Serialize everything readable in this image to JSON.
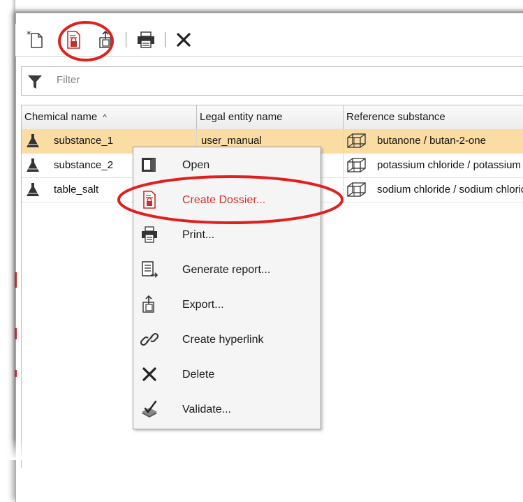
{
  "accent_color": "#d2312e",
  "selected_row_color": "#fbdca2",
  "toolbar": {
    "buttons": [
      {
        "name": "new-icon"
      },
      {
        "name": "create-dossier-icon"
      },
      {
        "name": "export-icon"
      },
      {
        "name": "print-icon"
      },
      {
        "name": "delete-icon"
      }
    ]
  },
  "filter": {
    "placeholder": "Filter"
  },
  "table": {
    "columns": [
      "Chemical name",
      "Legal entity name",
      "Reference substance"
    ],
    "sort_indicator": "^",
    "rows": [
      {
        "chemical_name": "substance_1",
        "legal_entity": "user_manual",
        "reference": "butanone / butan-2-one"
      },
      {
        "chemical_name": "substance_2",
        "legal_entity": "",
        "reference": "potassium chloride / potassium chloride"
      },
      {
        "chemical_name": "table_salt",
        "legal_entity": "",
        "reference": "sodium chloride / sodium chloride"
      }
    ]
  },
  "context_menu": {
    "items": [
      {
        "label": "Open",
        "icon": "open-icon"
      },
      {
        "label": "Create Dossier...",
        "icon": "create-dossier-icon",
        "highlighted": true
      },
      {
        "label": "Print...",
        "icon": "print-icon"
      },
      {
        "label": "Generate report...",
        "icon": "report-icon"
      },
      {
        "label": "Export...",
        "icon": "export-icon"
      },
      {
        "label": "Create hyperlink",
        "icon": "link-icon"
      },
      {
        "label": "Delete",
        "icon": "delete-icon"
      },
      {
        "label": "Validate...",
        "icon": "validate-icon"
      }
    ]
  }
}
